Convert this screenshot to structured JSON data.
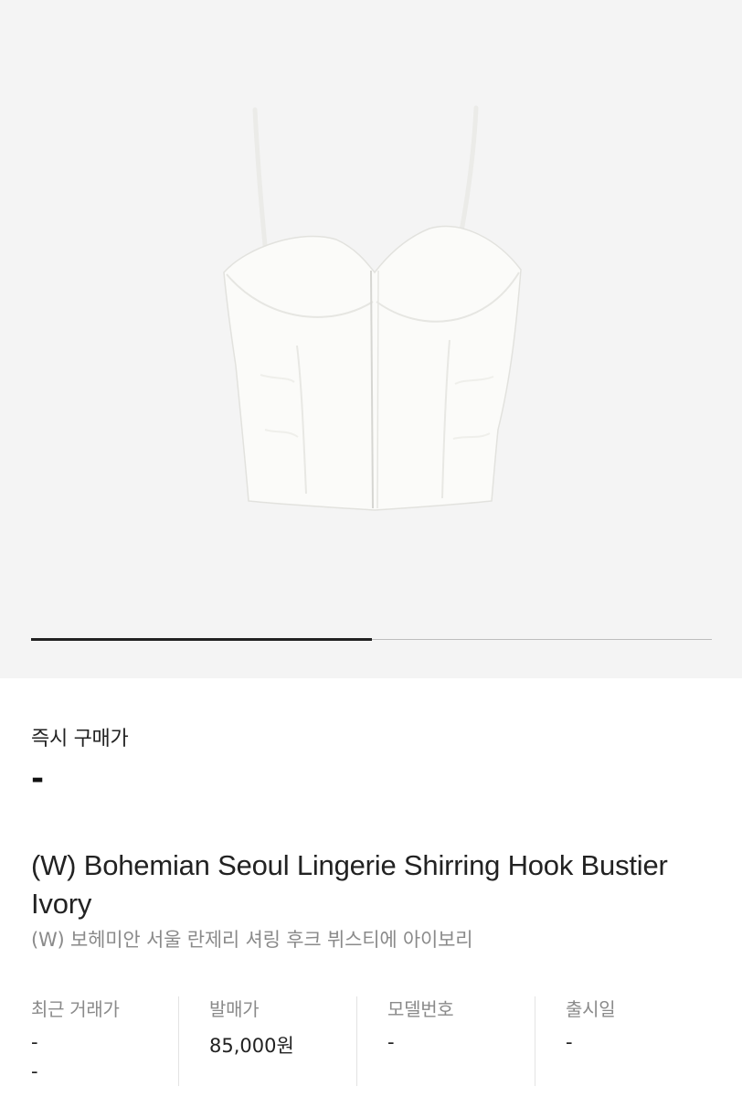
{
  "product": {
    "image_icon": "bustier-product-image",
    "carousel_progress": 0.5
  },
  "instant_buy": {
    "label": "즉시 구매가",
    "value": "-"
  },
  "title": {
    "en": "(W) Bohemian Seoul Lingerie Shirring Hook Bustier Ivory",
    "ko": "(W) 보헤미안 서울 란제리 셔링 후크 뷔스티에 아이보리"
  },
  "info": {
    "recent_price": {
      "label": "최근 거래가",
      "value": "-",
      "sub": "-"
    },
    "release_price": {
      "label": "발매가",
      "value": "85,000원"
    },
    "model_number": {
      "label": "모델번호",
      "value": "-"
    },
    "release_date": {
      "label": "출시일",
      "value": "-"
    }
  }
}
